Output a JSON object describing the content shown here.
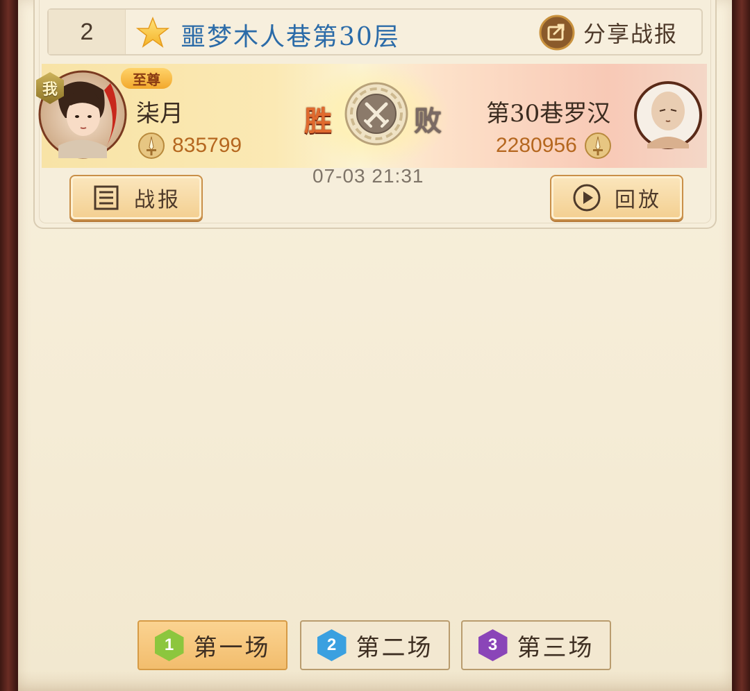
{
  "battle": {
    "rank": "2",
    "title": "噩梦木人巷第30层",
    "share_label": "分享战报",
    "timestamp": "07-03 21:31",
    "result_left": "胜",
    "result_right": "败"
  },
  "player_left": {
    "me_badge": "我",
    "vip_label": "至尊",
    "name": "柒月",
    "power": "835799"
  },
  "player_right": {
    "name": "第30巷罗汉",
    "power": "2280956"
  },
  "actions": {
    "report_label": "战报",
    "replay_label": "回放"
  },
  "rounds": [
    {
      "num": "1",
      "label": "第一场",
      "active": true,
      "color": "#8cc63e"
    },
    {
      "num": "2",
      "label": "第二场",
      "active": false,
      "color": "#3aa0e0"
    },
    {
      "num": "3",
      "label": "第三场",
      "active": false,
      "color": "#8a45b8"
    }
  ],
  "colors": {
    "title_blue": "#2b6ba8",
    "win_orange": "#e06a2e",
    "power_gold": "#b5671f",
    "tab_active": "#f2bd6d"
  },
  "icons": {
    "star": "star-icon",
    "share": "share-icon",
    "sword": "sword-icon",
    "vs": "crossed-swords-icon",
    "report": "list-icon",
    "replay": "play-icon"
  }
}
